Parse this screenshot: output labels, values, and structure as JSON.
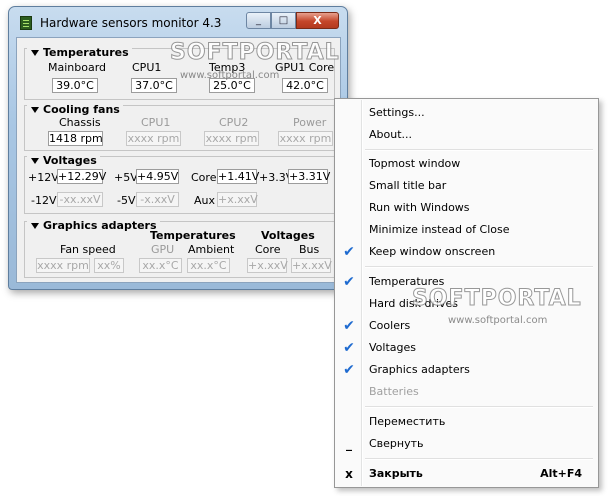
{
  "window": {
    "title": "Hardware sensors monitor 4.3",
    "caption": {
      "minimize": "_",
      "maximize": "□",
      "close": "X"
    },
    "temperatures": {
      "heading": "Temperatures",
      "labels": [
        "Mainboard",
        "CPU1",
        "Temp3",
        "GPU1 Core"
      ],
      "values": [
        "39.0°C",
        "37.0°C",
        "25.0°C",
        "42.0°C"
      ]
    },
    "cooling_fans": {
      "heading": "Cooling fans",
      "labels": [
        "Chassis",
        "CPU1",
        "CPU2",
        "Power"
      ],
      "values": [
        "1418 rpm",
        "xxxx rpm",
        "xxxx rpm",
        "xxxx rpm"
      ]
    },
    "voltages": {
      "heading": "Voltages",
      "row1": [
        {
          "label": "+12V",
          "value": "+12.29V"
        },
        {
          "label": "+5V",
          "value": "+4.95V"
        },
        {
          "label": "Core",
          "value": "+1.41V"
        },
        {
          "label": "+3.3V",
          "value": "+3.31V"
        }
      ],
      "row2": [
        {
          "label": "-12V",
          "value": "-xx.xxV"
        },
        {
          "label": "-5V",
          "value": "-x.xxV"
        },
        {
          "label": "Aux",
          "value": "+x.xxV"
        }
      ]
    },
    "graphics": {
      "heading": "Graphics adapters",
      "temps_heading": "Temperatures",
      "volts_heading": "Voltages",
      "labels": {
        "fan": "Fan speed",
        "gpu": "GPU",
        "ambient": "Ambient",
        "core": "Core",
        "bus": "Bus"
      },
      "values": {
        "fan_rpm": "xxxx rpm",
        "fan_pct": "xx%",
        "gpu": "xx.x°C",
        "ambient": "xx.x°C",
        "core": "+x.xxV",
        "bus": "+x.xxV"
      }
    }
  },
  "menu": {
    "items": [
      {
        "label": "Settings..."
      },
      {
        "label": "About..."
      },
      {
        "label": "Topmost window"
      },
      {
        "label": "Small title bar"
      },
      {
        "label": "Run with Windows"
      },
      {
        "label": "Minimize instead of Close"
      },
      {
        "label": "Keep window onscreen",
        "checked": true
      },
      {
        "label": "Temperatures",
        "checked": true
      },
      {
        "label": "Hard disk drives"
      },
      {
        "label": "Coolers",
        "checked": true
      },
      {
        "label": "Voltages",
        "checked": true
      },
      {
        "label": "Graphics adapters",
        "checked": true
      },
      {
        "label": "Batteries",
        "disabled": true
      },
      {
        "label": "Переместить"
      },
      {
        "label": "Свернуть",
        "glyph": "_"
      },
      {
        "label": "Закрыть",
        "glyph": "x",
        "shortcut": "Alt+F4"
      }
    ],
    "check_glyph": "✔"
  },
  "watermark": {
    "brand": "SOFTPORTAL",
    "url": "www.softportal.com"
  }
}
